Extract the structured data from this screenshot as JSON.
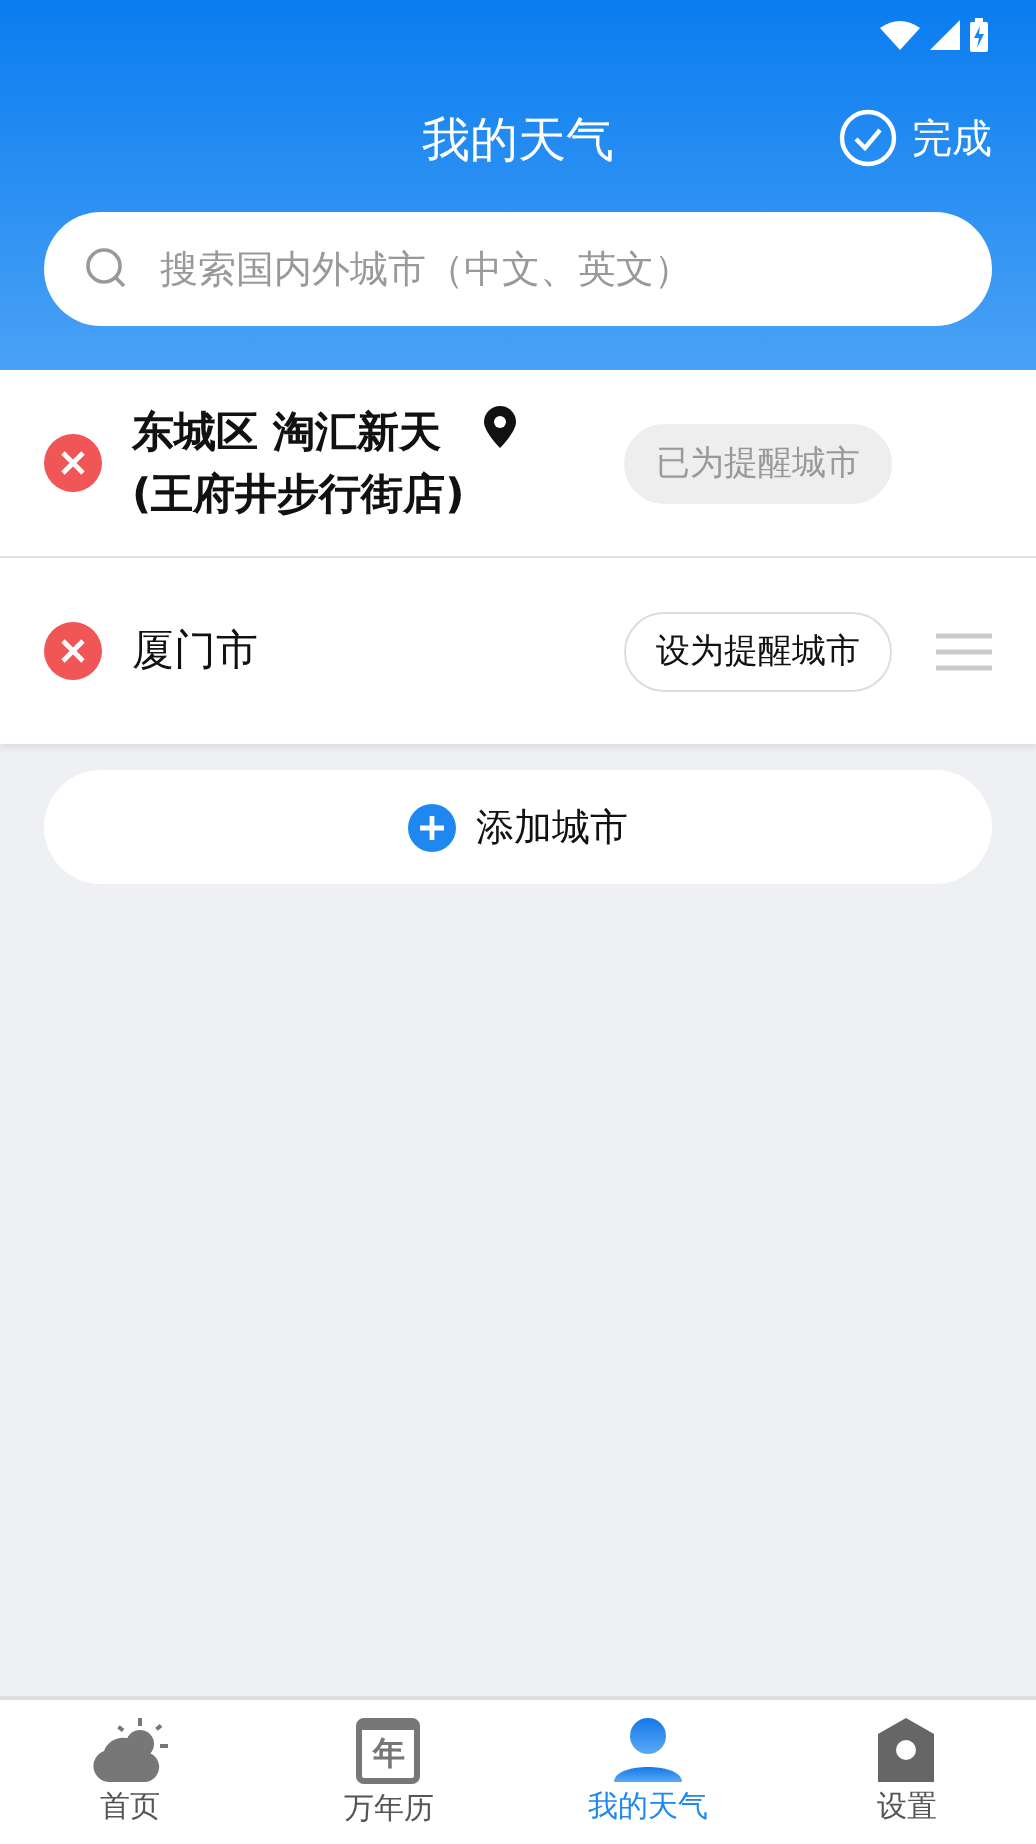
{
  "header": {
    "title": "我的天气",
    "done": "完成"
  },
  "search": {
    "placeholder": "搜索国内外城市（中文、英文）"
  },
  "cities": [
    {
      "name": "东城区 淘汇新天\n(王府井步行街店)",
      "located": true,
      "reminder": "已为提醒城市",
      "is_reminder": true,
      "draggable": false
    },
    {
      "name": "厦门市",
      "located": false,
      "reminder": "设为提醒城市",
      "is_reminder": false,
      "draggable": true
    }
  ],
  "add_button": "添加城市",
  "tabs": [
    {
      "kind": "weather",
      "label": "首页",
      "selected": false
    },
    {
      "kind": "calendar",
      "label": "万年历",
      "icon_text": "年",
      "selected": false
    },
    {
      "kind": "person",
      "label": "我的天气",
      "selected": true
    },
    {
      "kind": "settings",
      "label": "设置",
      "selected": false
    }
  ]
}
